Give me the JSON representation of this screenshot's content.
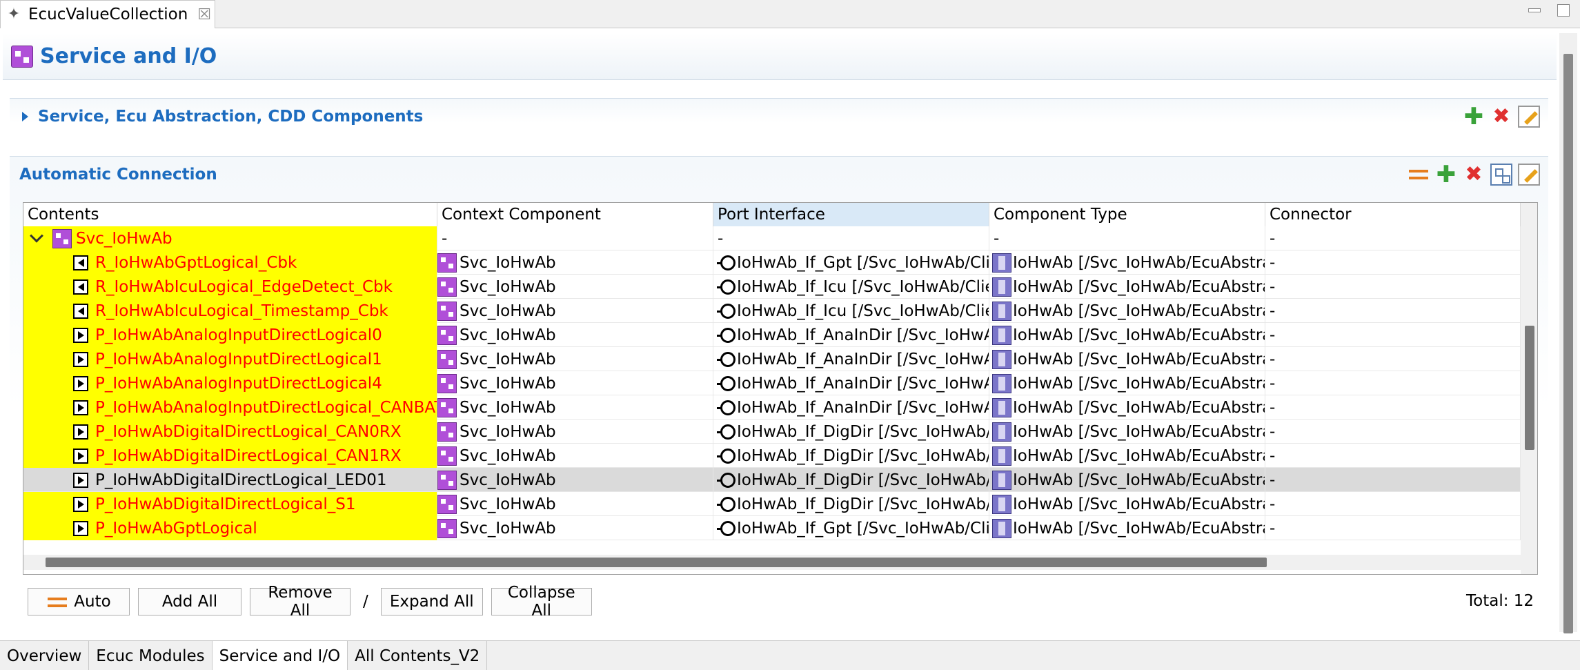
{
  "editor_tab": {
    "title": "EcucValueCollection"
  },
  "page": {
    "title": "Service and I/O"
  },
  "section_components": {
    "title": "Service, Ecu Abstraction, CDD Components"
  },
  "section_connection": {
    "title": "Automatic Connection"
  },
  "table": {
    "columns": [
      "Contents",
      "Context Component",
      "Port Interface",
      "Component Type",
      "Connector"
    ],
    "sorted_column": "Port Interface",
    "root": {
      "name": "Svc_IoHwAb",
      "context": "-",
      "port_interface": "-",
      "component_type": "-",
      "connector": "-"
    },
    "rows": [
      {
        "name": "R_IoHwAbGptLogical_Cbk",
        "direction": "R",
        "context": "Svc_IoHwAb",
        "port_interface": "IoHwAb_If_Gpt [/Svc_IoHwAb/Cli...",
        "component_type": "IoHwAb [/Svc_IoHwAb/EcuAbstra...",
        "connector": "-",
        "highlighted": true
      },
      {
        "name": "R_IoHwAbIcuLogical_EdgeDetect_Cbk",
        "direction": "R",
        "context": "Svc_IoHwAb",
        "port_interface": "IoHwAb_If_Icu [/Svc_IoHwAb/Clie...",
        "component_type": "IoHwAb [/Svc_IoHwAb/EcuAbstra...",
        "connector": "-",
        "highlighted": true
      },
      {
        "name": "R_IoHwAbIcuLogical_Timestamp_Cbk",
        "direction": "R",
        "context": "Svc_IoHwAb",
        "port_interface": "IoHwAb_If_Icu [/Svc_IoHwAb/Clie...",
        "component_type": "IoHwAb [/Svc_IoHwAb/EcuAbstra...",
        "connector": "-",
        "highlighted": true
      },
      {
        "name": "P_IoHwAbAnalogInputDirectLogical0",
        "direction": "P",
        "context": "Svc_IoHwAb",
        "port_interface": "IoHwAb_If_AnaInDir [/Svc_IoHwA...",
        "component_type": "IoHwAb [/Svc_IoHwAb/EcuAbstra...",
        "connector": "-",
        "highlighted": true
      },
      {
        "name": "P_IoHwAbAnalogInputDirectLogical1",
        "direction": "P",
        "context": "Svc_IoHwAb",
        "port_interface": "IoHwAb_If_AnaInDir [/Svc_IoHwA...",
        "component_type": "IoHwAb [/Svc_IoHwAb/EcuAbstra...",
        "connector": "-",
        "highlighted": true
      },
      {
        "name": "P_IoHwAbAnalogInputDirectLogical4",
        "direction": "P",
        "context": "Svc_IoHwAb",
        "port_interface": "IoHwAb_If_AnaInDir [/Svc_IoHwA...",
        "component_type": "IoHwAb [/Svc_IoHwAb/EcuAbstra...",
        "connector": "-",
        "highlighted": true
      },
      {
        "name": "P_IoHwAbAnalogInputDirectLogical_CANBAT",
        "direction": "P",
        "context": "Svc_IoHwAb",
        "port_interface": "IoHwAb_If_AnaInDir [/Svc_IoHwA...",
        "component_type": "IoHwAb [/Svc_IoHwAb/EcuAbstra...",
        "connector": "-",
        "highlighted": true
      },
      {
        "name": "P_IoHwAbDigitalDirectLogical_CAN0RX",
        "direction": "P",
        "context": "Svc_IoHwAb",
        "port_interface": "IoHwAb_If_DigDir [/Svc_IoHwAb/...",
        "component_type": "IoHwAb [/Svc_IoHwAb/EcuAbstra...",
        "connector": "-",
        "highlighted": true
      },
      {
        "name": "P_IoHwAbDigitalDirectLogical_CAN1RX",
        "direction": "P",
        "context": "Svc_IoHwAb",
        "port_interface": "IoHwAb_If_DigDir [/Svc_IoHwAb/...",
        "component_type": "IoHwAb [/Svc_IoHwAb/EcuAbstra...",
        "connector": "-",
        "highlighted": true
      },
      {
        "name": "P_IoHwAbDigitalDirectLogical_LED01",
        "direction": "P",
        "context": "Svc_IoHwAb",
        "port_interface": "IoHwAb_If_DigDir [/Svc_IoHwAb/...",
        "component_type": "IoHwAb [/Svc_IoHwAb/EcuAbstra...",
        "connector": "-",
        "highlighted": false,
        "selected": true
      },
      {
        "name": "P_IoHwAbDigitalDirectLogical_S1",
        "direction": "P",
        "context": "Svc_IoHwAb",
        "port_interface": "IoHwAb_If_DigDir [/Svc_IoHwAb/...",
        "component_type": "IoHwAb [/Svc_IoHwAb/EcuAbstra...",
        "connector": "-",
        "highlighted": true
      },
      {
        "name": "P_IoHwAbGptLogical",
        "direction": "P",
        "context": "Svc_IoHwAb",
        "port_interface": "IoHwAb_If_Gpt [/Svc_IoHwAb/Cli...",
        "component_type": "IoHwAb [/Svc_IoHwAb/EcuAbstra...",
        "connector": "-",
        "highlighted": true
      }
    ]
  },
  "buttons": {
    "auto": "Auto",
    "add_all": "Add All",
    "remove_all": "Remove All",
    "separator": "/",
    "expand_all": "Expand All",
    "collapse_all": "Collapse All"
  },
  "total": "Total: 12",
  "page_tabs": [
    "Overview",
    "Ecuc Modules",
    "Service and I/O",
    "All Contents_V2"
  ],
  "active_page_tab": "Service and I/O",
  "colors": {
    "highlight": "#ffff00",
    "highlight_text": "#ff0000",
    "title_blue": "#1d6cbf",
    "selected_row": "#dadada"
  }
}
